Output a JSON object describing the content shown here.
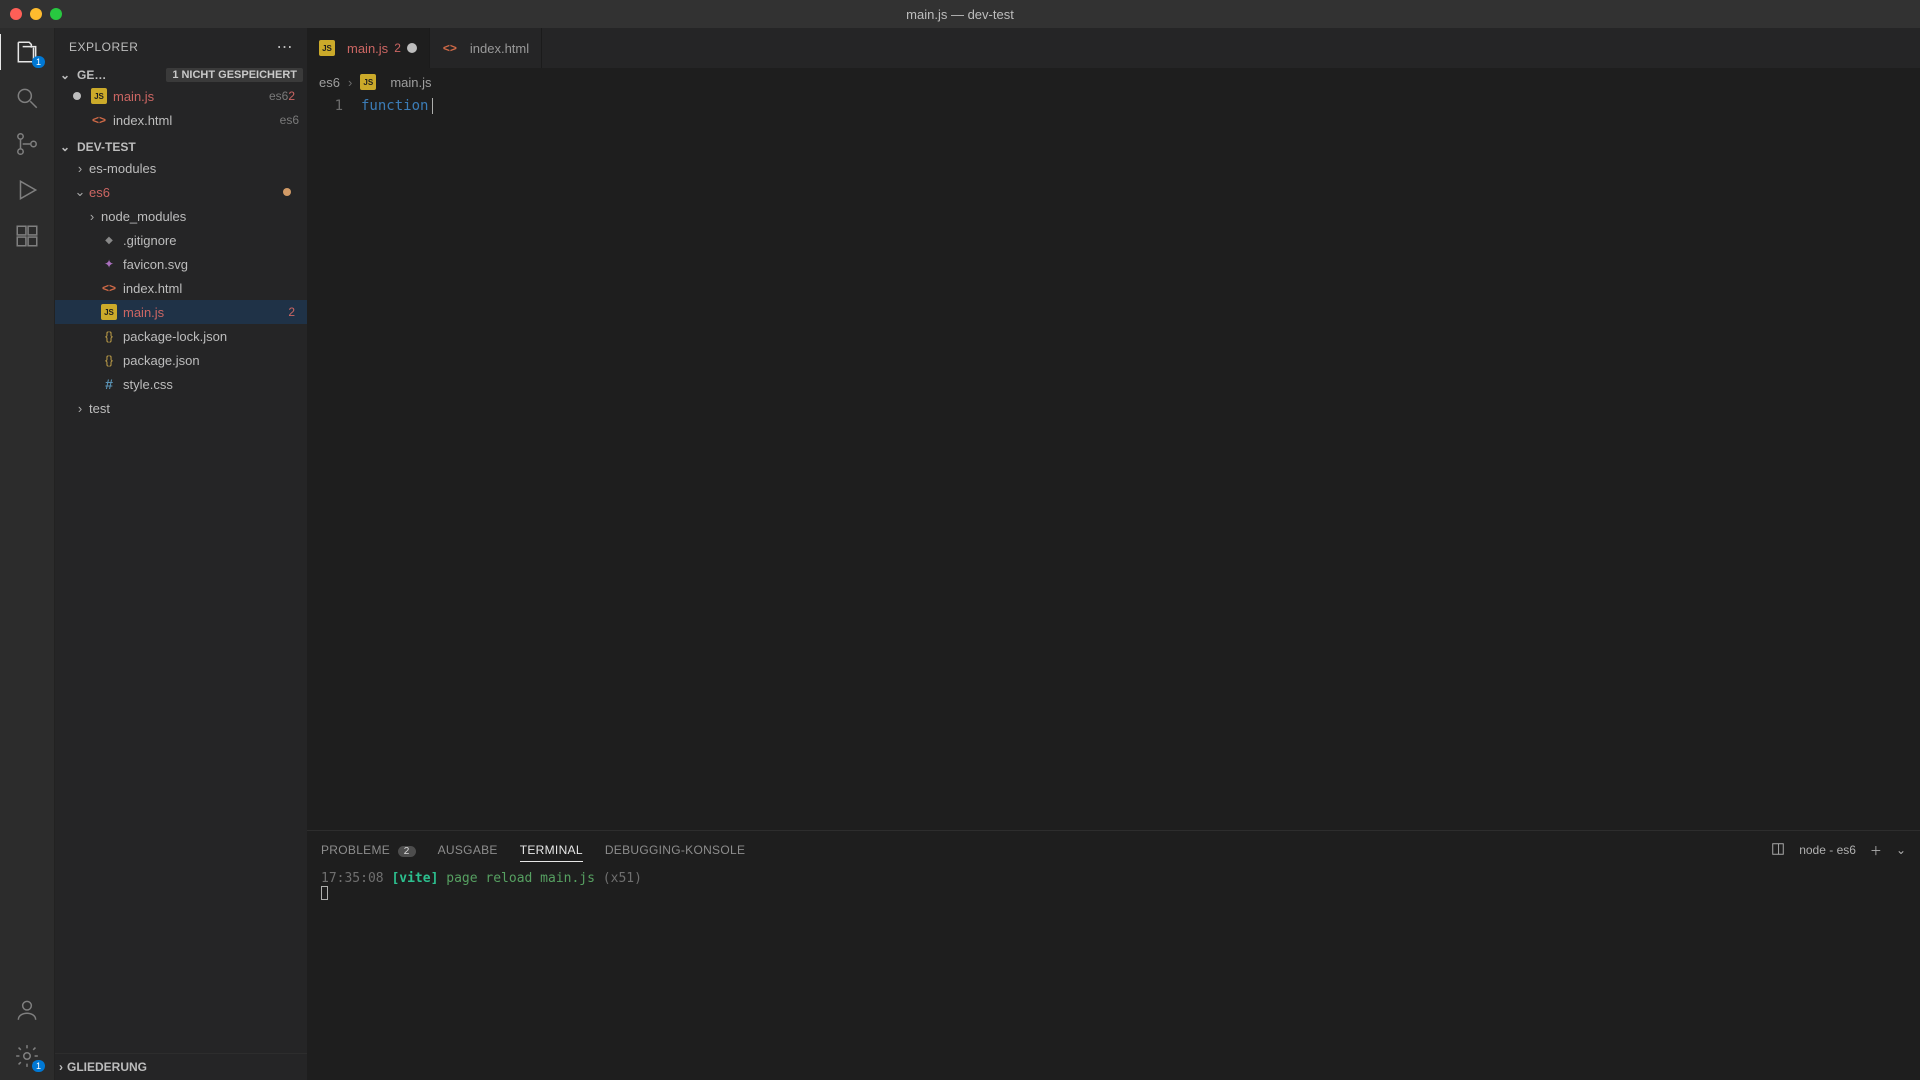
{
  "window_title": "main.js — dev-test",
  "activitybar": {
    "explorer_badge": "1"
  },
  "sidebar": {
    "title": "EXPLORER",
    "open_editors_label": "GE…",
    "unsaved_label": "1 NICHT GESPEICHERT",
    "open_editors": [
      {
        "label": "main.js",
        "tag": "es6",
        "error": "2",
        "dirty": true
      },
      {
        "label": "index.html",
        "tag": "es6"
      }
    ],
    "project_label": "DEV-TEST",
    "tree": {
      "es_modules": "es-modules",
      "es6": "es6",
      "node_modules": "node_modules",
      "gitignore": ".gitignore",
      "favicon": "favicon.svg",
      "indexhtml": "index.html",
      "mainjs": "main.js",
      "mainjs_err": "2",
      "pkg_lock": "package-lock.json",
      "pkg": "package.json",
      "style": "style.css",
      "test": "test"
    },
    "outline_label": "GLIEDERUNG"
  },
  "tabs": [
    {
      "label": "main.js",
      "err": "2",
      "dirty": true,
      "active": true
    },
    {
      "label": "index.html"
    }
  ],
  "breadcrumb": {
    "folder": "es6",
    "file": "main.js"
  },
  "editor": {
    "line1_num": "1",
    "line1_keyword": "function"
  },
  "panel": {
    "tabs": {
      "probleme": "PROBLEME",
      "probleme_count": "2",
      "ausgabe": "AUSGABE",
      "terminal": "TERMINAL",
      "debug": "DEBUGGING-KONSOLE"
    },
    "terminal_label": "node - es6",
    "line": {
      "time": "17:35:08",
      "vite": "[vite]",
      "msg": "page reload",
      "file": "main.js",
      "count": "(x51)"
    }
  }
}
